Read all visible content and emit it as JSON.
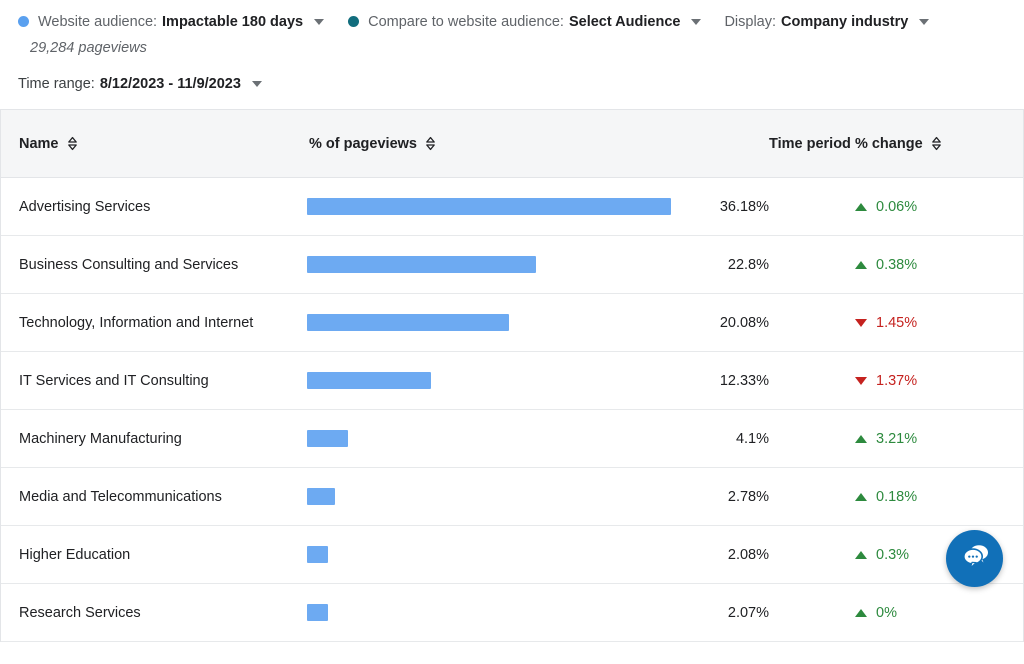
{
  "filters": [
    {
      "dot_color": "#5aa0ef",
      "label": "Website audience:",
      "value": "Impactable 180 days",
      "has_caret": true
    },
    {
      "dot_color": "#116d7d",
      "label": "Compare to website audience:",
      "value": "Select Audience",
      "has_caret": true
    },
    {
      "dot_color": null,
      "label": "Display:",
      "value": "Company industry",
      "has_caret": true
    }
  ],
  "pageviews_text": "29,284 pageviews",
  "time_range": {
    "label": "Time range:",
    "value": "8/12/2023 - 11/9/2023"
  },
  "table": {
    "columns": [
      {
        "label": "Name",
        "sortable": true
      },
      {
        "label": "% of pageviews",
        "sortable": true
      },
      {
        "label": "Time period % change",
        "sortable": true
      }
    ],
    "rows": [
      {
        "name": "Advertising Services",
        "pct_label": "36.18%",
        "pct_value": 36.18,
        "change": "0.06%",
        "direction": "up"
      },
      {
        "name": "Business Consulting and Services",
        "pct_label": "22.8%",
        "pct_value": 22.8,
        "change": "0.38%",
        "direction": "up"
      },
      {
        "name": "Technology, Information and Internet",
        "pct_label": "20.08%",
        "pct_value": 20.08,
        "change": "1.45%",
        "direction": "down"
      },
      {
        "name": "IT Services and IT Consulting",
        "pct_label": "12.33%",
        "pct_value": 12.33,
        "change": "1.37%",
        "direction": "down"
      },
      {
        "name": "Machinery Manufacturing",
        "pct_label": "4.1%",
        "pct_value": 4.1,
        "change": "3.21%",
        "direction": "up"
      },
      {
        "name": "Media and Telecommunications",
        "pct_label": "2.78%",
        "pct_value": 2.78,
        "change": "0.18%",
        "direction": "up"
      },
      {
        "name": "Higher Education",
        "pct_label": "2.08%",
        "pct_value": 2.08,
        "change": "0.3%",
        "direction": "up"
      },
      {
        "name": "Research Services",
        "pct_label": "2.07%",
        "pct_value": 2.07,
        "change": "0%",
        "direction": "up"
      }
    ]
  },
  "chart_data": {
    "type": "bar",
    "title": "% of pageviews by Company industry",
    "xlabel": "% of pageviews",
    "ylabel": "",
    "categories": [
      "Advertising Services",
      "Business Consulting and Services",
      "Technology, Information and Internet",
      "IT Services and IT Consulting",
      "Machinery Manufacturing",
      "Media and Telecommunications",
      "Higher Education",
      "Research Services"
    ],
    "values": [
      36.18,
      22.8,
      20.08,
      12.33,
      4.1,
      2.78,
      2.08,
      2.07
    ],
    "value_labels": [
      "36.18%",
      "22.8%",
      "20.08%",
      "12.33%",
      "4.1%",
      "2.78%",
      "2.08%",
      "2.07%"
    ],
    "series": [
      {
        "name": "% of pageviews",
        "values": [
          36.18,
          22.8,
          20.08,
          12.33,
          4.1,
          2.78,
          2.08,
          2.07
        ]
      },
      {
        "name": "Time period % change",
        "values": [
          0.06,
          0.38,
          -1.45,
          -1.37,
          3.21,
          0.18,
          0.3,
          0
        ]
      }
    ],
    "xlim": [
      0,
      100
    ],
    "grid": false,
    "legend": "none",
    "bar_color": "#6daaf2",
    "positive_color": "#2d8a3e",
    "negative_color": "#c5221f",
    "total_pageviews": "29,284",
    "time_range": "8/12/2023 - 11/9/2023"
  },
  "chat_widget": {
    "icon": "chat-bubbles-icon",
    "color": "#1170b8"
  }
}
